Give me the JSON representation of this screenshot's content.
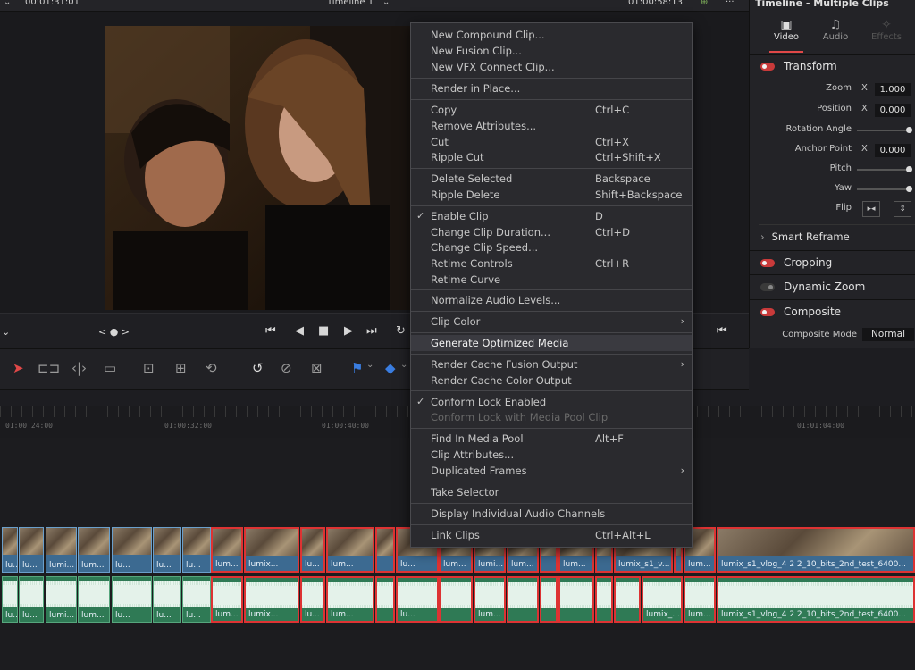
{
  "topbar": {
    "timecode_left": "00:01:31:01",
    "timeline_name": "Timeline 1",
    "timecode_right": "01:00:58:13",
    "inspector_title": "Timeline - Multiple Clips"
  },
  "inspector": {
    "tabs": [
      {
        "label": "Video"
      },
      {
        "label": "Audio"
      },
      {
        "label": "Effects"
      }
    ],
    "sections": {
      "transform": "Transform",
      "smart_reframe": "Smart Reframe",
      "cropping": "Cropping",
      "dynamic_zoom": "Dynamic Zoom",
      "composite": "Composite"
    },
    "params": {
      "zoom_label": "Zoom",
      "zoom_axis": "X",
      "zoom_value": "1.000",
      "position_label": "Position",
      "position_axis": "X",
      "position_value": "0.000",
      "rotation_label": "Rotation Angle",
      "anchor_label": "Anchor Point",
      "anchor_axis": "X",
      "anchor_value": "0.000",
      "pitch_label": "Pitch",
      "yaw_label": "Yaw",
      "flip_label": "Flip",
      "composite_mode_label": "Composite Mode",
      "composite_mode_value": "Normal"
    }
  },
  "ruler": {
    "ticks": [
      "01:00:24:00",
      "01:00:32:00",
      "01:00:40:00",
      "01:01:04:00"
    ]
  },
  "menu": {
    "items": [
      {
        "label": "New Compound Clip...",
        "shortcut": ""
      },
      {
        "label": "New Fusion Clip...",
        "shortcut": ""
      },
      {
        "label": "New VFX Connect Clip...",
        "shortcut": ""
      },
      {
        "label": "Render in Place...",
        "shortcut": ""
      },
      {
        "label": "Copy",
        "shortcut": "Ctrl+C"
      },
      {
        "label": "Remove Attributes...",
        "shortcut": ""
      },
      {
        "label": "Cut",
        "shortcut": "Ctrl+X"
      },
      {
        "label": "Ripple Cut",
        "shortcut": "Ctrl+Shift+X"
      },
      {
        "label": "Delete Selected",
        "shortcut": "Backspace"
      },
      {
        "label": "Ripple Delete",
        "shortcut": "Shift+Backspace"
      },
      {
        "label": "Enable Clip",
        "shortcut": "D"
      },
      {
        "label": "Change Clip Duration...",
        "shortcut": "Ctrl+D"
      },
      {
        "label": "Change Clip Speed...",
        "shortcut": ""
      },
      {
        "label": "Retime Controls",
        "shortcut": "Ctrl+R"
      },
      {
        "label": "Retime Curve",
        "shortcut": ""
      },
      {
        "label": "Normalize Audio Levels...",
        "shortcut": ""
      },
      {
        "label": "Clip Color",
        "shortcut": ""
      },
      {
        "label": "Generate Optimized Media",
        "shortcut": ""
      },
      {
        "label": "Render Cache Fusion Output",
        "shortcut": ""
      },
      {
        "label": "Render Cache Color Output",
        "shortcut": ""
      },
      {
        "label": "Conform Lock Enabled",
        "shortcut": ""
      },
      {
        "label": "Conform Lock with Media Pool Clip",
        "shortcut": ""
      },
      {
        "label": "Find In Media Pool",
        "shortcut": "Alt+F"
      },
      {
        "label": "Clip Attributes...",
        "shortcut": ""
      },
      {
        "label": "Duplicated Frames",
        "shortcut": ""
      },
      {
        "label": "Take Selector",
        "shortcut": ""
      },
      {
        "label": "Display Individual Audio Channels",
        "shortcut": ""
      },
      {
        "label": "Link Clips",
        "shortcut": "Ctrl+Alt+L"
      }
    ]
  },
  "timeline": {
    "video_labels": [
      "lu...",
      "lumi...",
      "lum...",
      "lu...",
      "lu...",
      "lum...",
      "lumix...",
      "lu...",
      "lum...",
      "lu...",
      "lum...",
      "lumi...",
      "lum...",
      "lumix_s1_v...",
      "lum...",
      "lumix_s1_vlog_4 2 2_10_bits_2nd_test_6400..."
    ],
    "audio_labels": [
      "lu...",
      "lumi...",
      "lum...",
      "lu...",
      "lu...",
      "lum...",
      "lumix...",
      "lu...",
      "lum...",
      "lu...",
      "lum...",
      "lumi...",
      "lum...",
      "lumix_...",
      "lum...",
      "lumix_s1_vlog_4 2 2_10_bits_2nd_test_6400..."
    ]
  },
  "colors": {
    "accent_red": "#d33333",
    "video_clip": "#3c6a91",
    "audio_clip": "#2f7a55",
    "menu_bg": "#2a2a2e"
  }
}
